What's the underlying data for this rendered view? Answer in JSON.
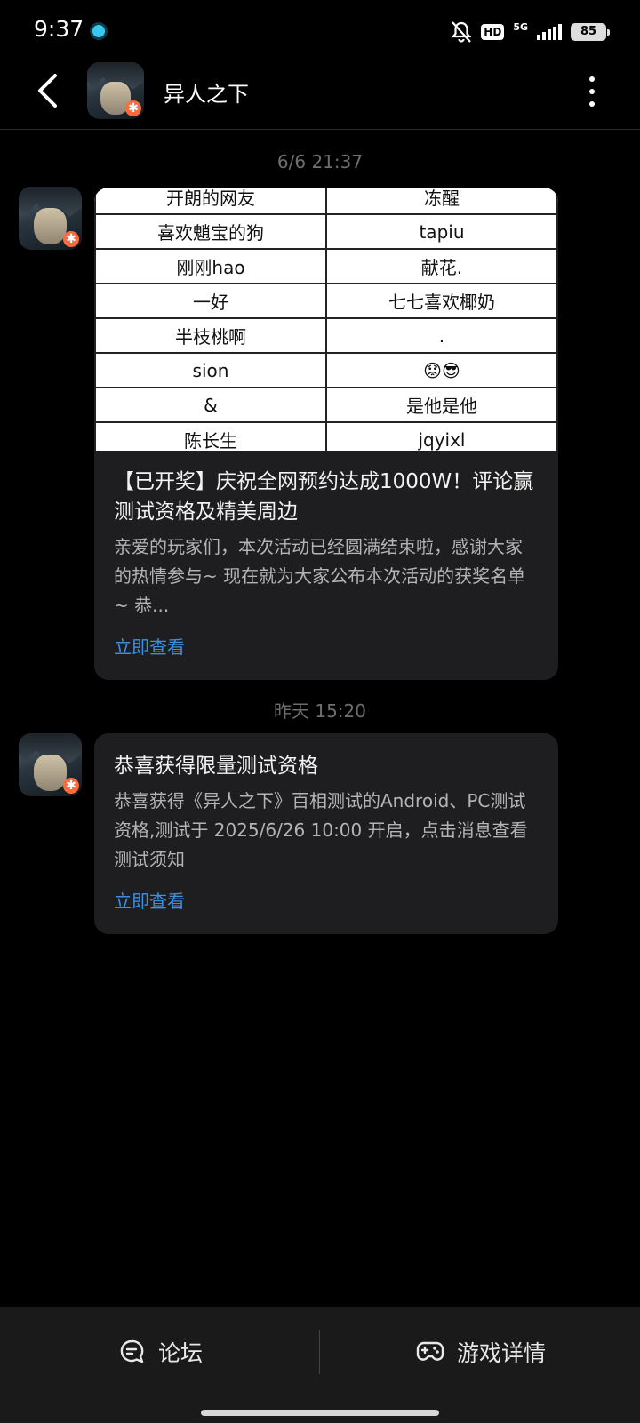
{
  "status_bar": {
    "time": "9:37",
    "hd": "HD",
    "network": "5G",
    "battery": "85",
    "icons": [
      "app-notification-icon",
      "bell-muted-icon",
      "hd-icon",
      "signal-icon",
      "battery-icon"
    ]
  },
  "header": {
    "title": "异人之下",
    "icons": [
      "back-arrow-icon",
      "more-vertical-icon"
    ]
  },
  "messages": [
    {
      "time": "6/6  21:37",
      "table_rows": [
        [
          "开朗的网友",
          "冻醒"
        ],
        [
          "喜欢魈宝的狗",
          "tapiu"
        ],
        [
          "刚刚hao",
          "献花."
        ],
        [
          "一好",
          "七七喜欢椰奶"
        ],
        [
          "半枝桃啊",
          "."
        ],
        [
          "sion",
          "😟😎"
        ],
        [
          "&",
          "是他是他"
        ],
        [
          "陈长生",
          "jqyixl"
        ]
      ],
      "title": "【已开奖】庆祝全网预约达成1000W！评论赢测试资格及精美周边",
      "desc": "亲爱的玩家们，本次活动已经圆满结束啦，感谢大家的热情参与~ 现在就为大家公布本次活动的获奖名单~ 恭...",
      "link": "立即查看"
    },
    {
      "time": "昨天  15:20",
      "title": "恭喜获得限量测试资格",
      "desc": "恭喜获得《异人之下》百相测试的Android、PC测试资格,测试于 2025/6/26 10:00 开启，点击消息查看测试须知",
      "link": "立即查看"
    }
  ],
  "bottom_bar": {
    "forum": "论坛",
    "game_details": "游戏详情"
  },
  "colors": {
    "background": "#000000",
    "card": "#1e1e20",
    "link": "#3d8fe0",
    "muted_text": "#6e6e6e"
  }
}
